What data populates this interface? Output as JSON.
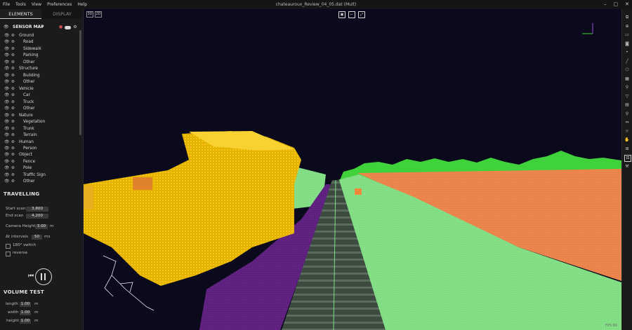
{
  "menu": {
    "items": [
      "File",
      "Tools",
      "View",
      "Preferences",
      "Help"
    ],
    "title": "chateauroux_Review_04_05.dat (Mult)",
    "window": [
      "–",
      "▢",
      "✕"
    ]
  },
  "tabs": [
    "ELEMENTS",
    "DISPLAY"
  ],
  "sensor_map": {
    "label": "SENSOR MAP"
  },
  "tree": [
    {
      "label": "Ground",
      "indent": 0
    },
    {
      "label": "Road",
      "indent": 1
    },
    {
      "label": "Sidewalk",
      "indent": 1
    },
    {
      "label": "Parking",
      "indent": 1
    },
    {
      "label": "Other",
      "indent": 1
    },
    {
      "label": "Structure",
      "indent": 0
    },
    {
      "label": "Building",
      "indent": 1
    },
    {
      "label": "Other",
      "indent": 1
    },
    {
      "label": "Vehicle",
      "indent": 0
    },
    {
      "label": "Car",
      "indent": 1
    },
    {
      "label": "Truck",
      "indent": 1
    },
    {
      "label": "Other",
      "indent": 1
    },
    {
      "label": "Nature",
      "indent": 0
    },
    {
      "label": "Vegetation",
      "indent": 1
    },
    {
      "label": "Trunk",
      "indent": 1
    },
    {
      "label": "Terrain",
      "indent": 1
    },
    {
      "label": "Human",
      "indent": 0
    },
    {
      "label": "Person",
      "indent": 1
    },
    {
      "label": "Object",
      "indent": 0
    },
    {
      "label": "Fence",
      "indent": 1
    },
    {
      "label": "Pole",
      "indent": 1
    },
    {
      "label": "Traffic Sign",
      "indent": 1
    },
    {
      "label": "Other",
      "indent": 1
    }
  ],
  "travelling": {
    "title": "TRAVELLING",
    "start_label": "Start scan",
    "start_value": "3,800",
    "end_label": "End scan",
    "end_value": "4,200",
    "camera_label": "Camera Height",
    "camera_value": "3.00",
    "camera_unit": "m",
    "interval_label": "Δt intervals",
    "interval_value": "50",
    "interval_unit": "ms",
    "switch_label": "180° switch",
    "reverse_label": "reverse"
  },
  "volume": {
    "title": "VOLUME TEST",
    "length_label": "length",
    "length_value": "1.00",
    "length_unit": "m",
    "width_label": "width",
    "width_value": "1.00",
    "width_unit": "m",
    "height_label": "height",
    "height_value": "1.00",
    "height_unit": "m"
  },
  "viewport": {
    "btn_3d": "3D",
    "btn_2d": "2D",
    "watermark": "FPS 60"
  },
  "colors": {
    "road": "#6a2a8a",
    "vegetation": "#3fdc3f",
    "terrain": "#87e38a",
    "building": "#f3c318",
    "field": "#ee8748",
    "rail": "#3a4f3e",
    "sky": "#0a0a1c"
  }
}
